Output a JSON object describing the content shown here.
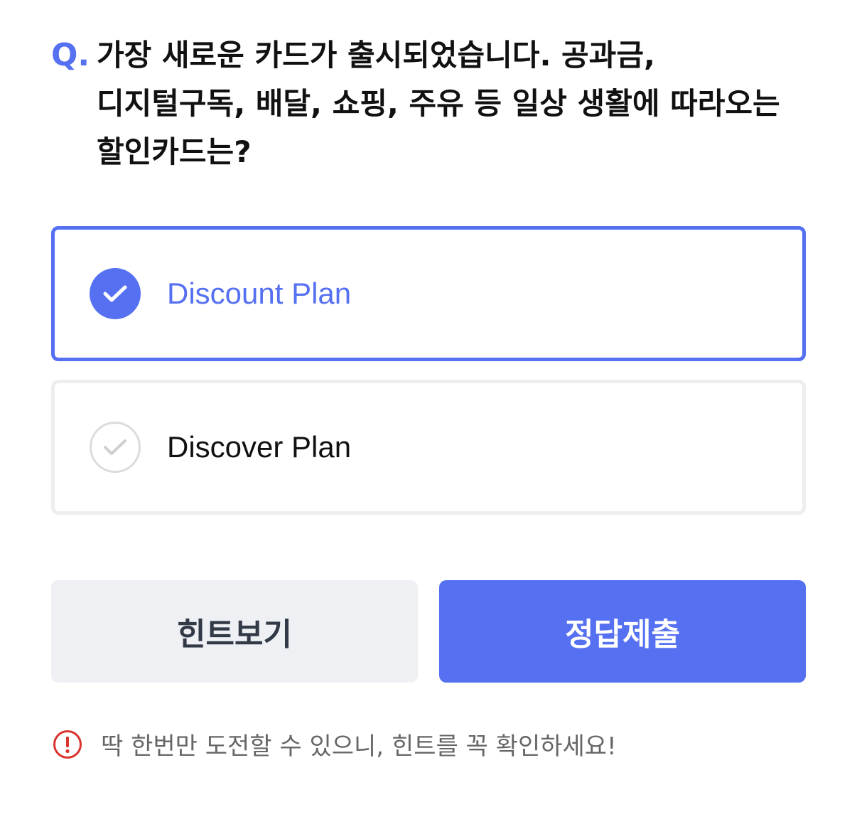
{
  "question": {
    "prefix": "Q.",
    "text": "가장 새로운 카드가 출시되었습니다. 공과금, 디지털구독, 배달, 쇼핑, 주유 등 일상 생활에 따라오는 할인카드는?"
  },
  "options": [
    {
      "label": "Discount Plan",
      "selected": true
    },
    {
      "label": "Discover Plan",
      "selected": false
    }
  ],
  "buttons": {
    "hint_label": "힌트보기",
    "submit_label": "정답제출"
  },
  "notice": {
    "text": "딱 한번만 도전할 수 있으니, 힌트를 꼭 확인하세요!",
    "icon": "exclamation-circle-icon"
  },
  "colors": {
    "accent": "#5570f1",
    "warning": "#d9332e",
    "hint_button_bg": "#eef0f4"
  }
}
